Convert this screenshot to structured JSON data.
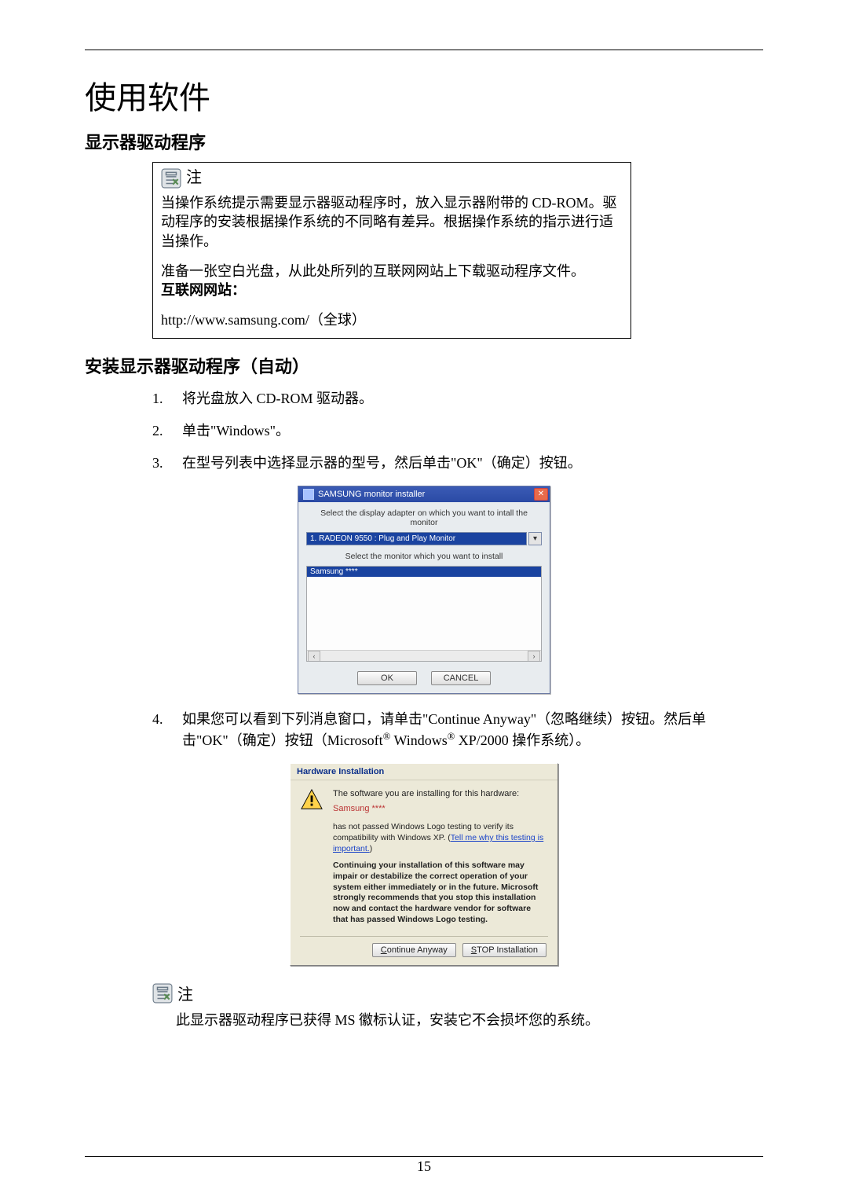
{
  "page": {
    "number": "15",
    "title": "使用软件",
    "section1": "显示器驱动程序",
    "section2": "安装显示器驱动程序（自动）"
  },
  "note_box": {
    "label": "注",
    "p1": "当操作系统提示需要显示器驱动程序时，放入显示器附带的 CD-ROM。驱动程序的安装根据操作系统的不同略有差异。根据操作系统的指示进行适当操作。",
    "p2": "准备一张空白光盘，从此处所列的互联网网站上下载驱动程序文件。",
    "label_internet": "互联网网站：",
    "url": "http://www.samsung.com/（全球）"
  },
  "steps": {
    "n1": "1.",
    "s1": "将光盘放入 CD-ROM 驱动器。",
    "n2": "2.",
    "s2": "单击\"Windows\"。",
    "n3": "3.",
    "s3": "在型号列表中选择显示器的型号，然后单击\"OK\"（确定）按钮。",
    "n4": "4.",
    "s4a": "如果您可以看到下列消息窗口，请单击\"Continue Anyway\"（忽略继续）按钮。然后单击\"OK\"（确定）按钮（Microsoft",
    "s4b": " Windows",
    "s4c": " XP/2000 操作系统）。"
  },
  "dlg_installer": {
    "title": "SAMSUNG monitor installer",
    "instr1": "Select the display adapter on which you want to intall the monitor",
    "adapter": "1. RADEON 9550 : Plug and Play Monitor",
    "instr2": "Select the monitor which you want to install",
    "selected": "Samsung ****",
    "ok": "OK",
    "cancel": "CANCEL"
  },
  "dlg_warn": {
    "title": "Hardware Installation",
    "line1": "The software you are installing for this hardware:",
    "device": "Samsung ****",
    "line2a": "has not passed Windows Logo testing to verify its compatibility with Windows XP. (",
    "link": "Tell me why this testing is important.",
    "line2b": ")",
    "bold": "Continuing your installation of this software may impair or destabilize the correct operation of your system either immediately or in the future. Microsoft strongly recommends that you stop this installation now and contact the hardware vendor for software that has passed Windows Logo testing.",
    "btn_continue_u": "C",
    "btn_continue_rest": "ontinue Anyway",
    "btn_stop_u": "S",
    "btn_stop_rest": "TOP Installation"
  },
  "note_footer": {
    "label": "注",
    "text": "此显示器驱动程序已获得 MS 徽标认证，安装它不会损坏您的系统。"
  }
}
